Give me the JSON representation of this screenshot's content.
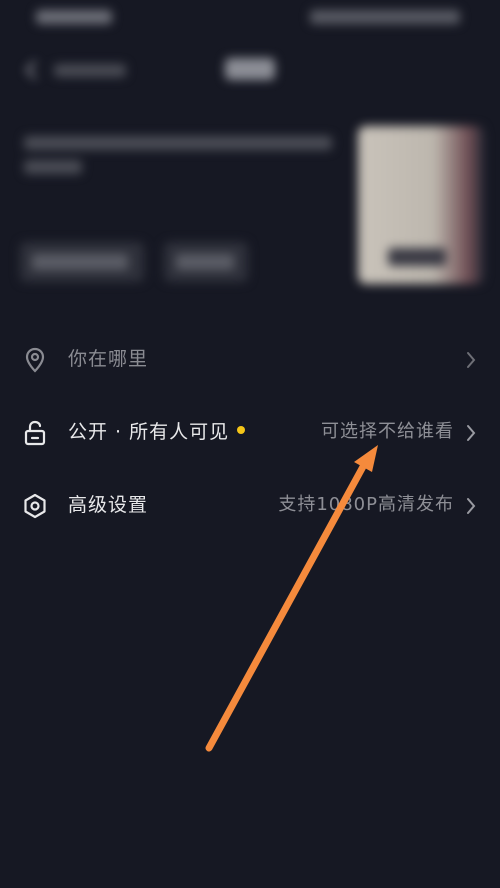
{
  "options": {
    "location": {
      "label": "你在哪里",
      "icon": "location-pin-icon"
    },
    "visibility": {
      "label": "公开 · 所有人可见",
      "value": "可选择不给谁看",
      "icon": "unlock-icon",
      "dot_color": "#f5c518"
    },
    "advanced": {
      "label": "高级设置",
      "value": "支持1080P高清发布",
      "icon": "hexagon-settings-icon"
    }
  },
  "colors": {
    "background": "#161823",
    "annotation_arrow": "#f58a3c"
  }
}
